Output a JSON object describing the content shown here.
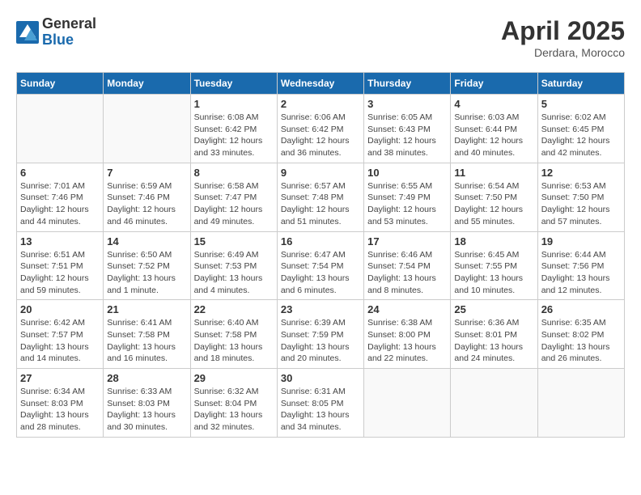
{
  "header": {
    "logo_general": "General",
    "logo_blue": "Blue",
    "month_title": "April 2025",
    "location": "Derdara, Morocco"
  },
  "weekdays": [
    "Sunday",
    "Monday",
    "Tuesday",
    "Wednesday",
    "Thursday",
    "Friday",
    "Saturday"
  ],
  "weeks": [
    [
      {
        "day": "",
        "info": ""
      },
      {
        "day": "",
        "info": ""
      },
      {
        "day": "1",
        "info": "Sunrise: 6:08 AM\nSunset: 6:42 PM\nDaylight: 12 hours and 33 minutes."
      },
      {
        "day": "2",
        "info": "Sunrise: 6:06 AM\nSunset: 6:42 PM\nDaylight: 12 hours and 36 minutes."
      },
      {
        "day": "3",
        "info": "Sunrise: 6:05 AM\nSunset: 6:43 PM\nDaylight: 12 hours and 38 minutes."
      },
      {
        "day": "4",
        "info": "Sunrise: 6:03 AM\nSunset: 6:44 PM\nDaylight: 12 hours and 40 minutes."
      },
      {
        "day": "5",
        "info": "Sunrise: 6:02 AM\nSunset: 6:45 PM\nDaylight: 12 hours and 42 minutes."
      }
    ],
    [
      {
        "day": "6",
        "info": "Sunrise: 7:01 AM\nSunset: 7:46 PM\nDaylight: 12 hours and 44 minutes."
      },
      {
        "day": "7",
        "info": "Sunrise: 6:59 AM\nSunset: 7:46 PM\nDaylight: 12 hours and 46 minutes."
      },
      {
        "day": "8",
        "info": "Sunrise: 6:58 AM\nSunset: 7:47 PM\nDaylight: 12 hours and 49 minutes."
      },
      {
        "day": "9",
        "info": "Sunrise: 6:57 AM\nSunset: 7:48 PM\nDaylight: 12 hours and 51 minutes."
      },
      {
        "day": "10",
        "info": "Sunrise: 6:55 AM\nSunset: 7:49 PM\nDaylight: 12 hours and 53 minutes."
      },
      {
        "day": "11",
        "info": "Sunrise: 6:54 AM\nSunset: 7:50 PM\nDaylight: 12 hours and 55 minutes."
      },
      {
        "day": "12",
        "info": "Sunrise: 6:53 AM\nSunset: 7:50 PM\nDaylight: 12 hours and 57 minutes."
      }
    ],
    [
      {
        "day": "13",
        "info": "Sunrise: 6:51 AM\nSunset: 7:51 PM\nDaylight: 12 hours and 59 minutes."
      },
      {
        "day": "14",
        "info": "Sunrise: 6:50 AM\nSunset: 7:52 PM\nDaylight: 13 hours and 1 minute."
      },
      {
        "day": "15",
        "info": "Sunrise: 6:49 AM\nSunset: 7:53 PM\nDaylight: 13 hours and 4 minutes."
      },
      {
        "day": "16",
        "info": "Sunrise: 6:47 AM\nSunset: 7:54 PM\nDaylight: 13 hours and 6 minutes."
      },
      {
        "day": "17",
        "info": "Sunrise: 6:46 AM\nSunset: 7:54 PM\nDaylight: 13 hours and 8 minutes."
      },
      {
        "day": "18",
        "info": "Sunrise: 6:45 AM\nSunset: 7:55 PM\nDaylight: 13 hours and 10 minutes."
      },
      {
        "day": "19",
        "info": "Sunrise: 6:44 AM\nSunset: 7:56 PM\nDaylight: 13 hours and 12 minutes."
      }
    ],
    [
      {
        "day": "20",
        "info": "Sunrise: 6:42 AM\nSunset: 7:57 PM\nDaylight: 13 hours and 14 minutes."
      },
      {
        "day": "21",
        "info": "Sunrise: 6:41 AM\nSunset: 7:58 PM\nDaylight: 13 hours and 16 minutes."
      },
      {
        "day": "22",
        "info": "Sunrise: 6:40 AM\nSunset: 7:58 PM\nDaylight: 13 hours and 18 minutes."
      },
      {
        "day": "23",
        "info": "Sunrise: 6:39 AM\nSunset: 7:59 PM\nDaylight: 13 hours and 20 minutes."
      },
      {
        "day": "24",
        "info": "Sunrise: 6:38 AM\nSunset: 8:00 PM\nDaylight: 13 hours and 22 minutes."
      },
      {
        "day": "25",
        "info": "Sunrise: 6:36 AM\nSunset: 8:01 PM\nDaylight: 13 hours and 24 minutes."
      },
      {
        "day": "26",
        "info": "Sunrise: 6:35 AM\nSunset: 8:02 PM\nDaylight: 13 hours and 26 minutes."
      }
    ],
    [
      {
        "day": "27",
        "info": "Sunrise: 6:34 AM\nSunset: 8:03 PM\nDaylight: 13 hours and 28 minutes."
      },
      {
        "day": "28",
        "info": "Sunrise: 6:33 AM\nSunset: 8:03 PM\nDaylight: 13 hours and 30 minutes."
      },
      {
        "day": "29",
        "info": "Sunrise: 6:32 AM\nSunset: 8:04 PM\nDaylight: 13 hours and 32 minutes."
      },
      {
        "day": "30",
        "info": "Sunrise: 6:31 AM\nSunset: 8:05 PM\nDaylight: 13 hours and 34 minutes."
      },
      {
        "day": "",
        "info": ""
      },
      {
        "day": "",
        "info": ""
      },
      {
        "day": "",
        "info": ""
      }
    ]
  ]
}
